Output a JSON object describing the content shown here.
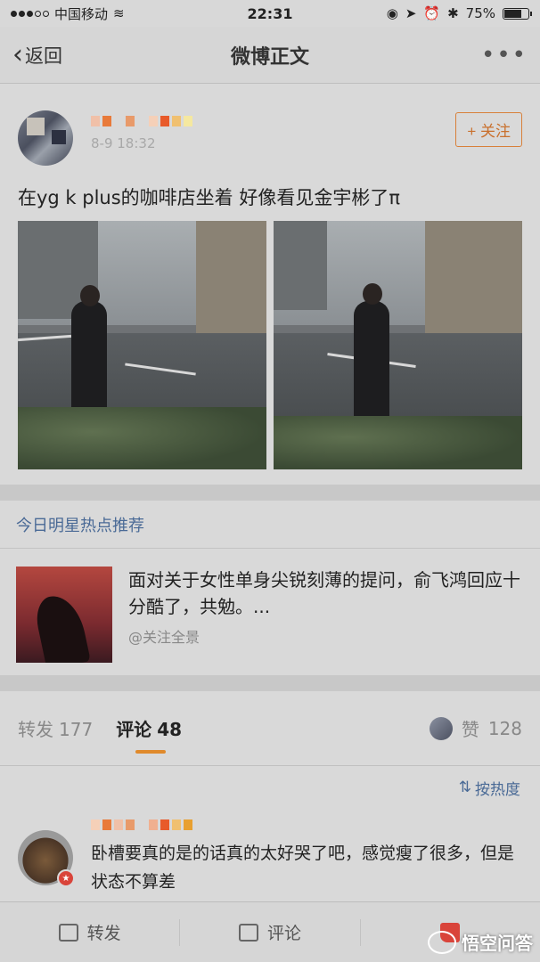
{
  "status_bar": {
    "carrier": "中国移动",
    "time": "22:31",
    "battery": "75%",
    "battery_level": 0.75
  },
  "navbar": {
    "back_label": "返回",
    "title": "微博正文",
    "more": "•••"
  },
  "post": {
    "time": "8-9 18:32",
    "follow_label": "+ 关注",
    "text": "在yg k plus的咖啡店坐着 好像看见金宇彬了π"
  },
  "recommend": {
    "section_title": "今日明星热点推荐",
    "item_text": "面对关于女性单身尖锐刻薄的提问，俞飞鸿回应十分酷了，共勉。...",
    "item_source": "@关注全景"
  },
  "tabs": {
    "repost_label": "转发",
    "repost_count": "177",
    "comment_label": "评论",
    "comment_count": "48",
    "like_label": "赞",
    "like_count": "128"
  },
  "sort": {
    "label": "按热度"
  },
  "comment": {
    "text": "卧槽要真的是的话真的太好哭了吧，感觉瘦了很多，但是状态不算差"
  },
  "bottom_bar": {
    "repost": "转发",
    "comment": "评论"
  },
  "watermark": {
    "text": "悟空问答"
  },
  "colors": {
    "accent": "#e08a2c",
    "link": "#4a6a96",
    "follow": "#c9702d"
  }
}
